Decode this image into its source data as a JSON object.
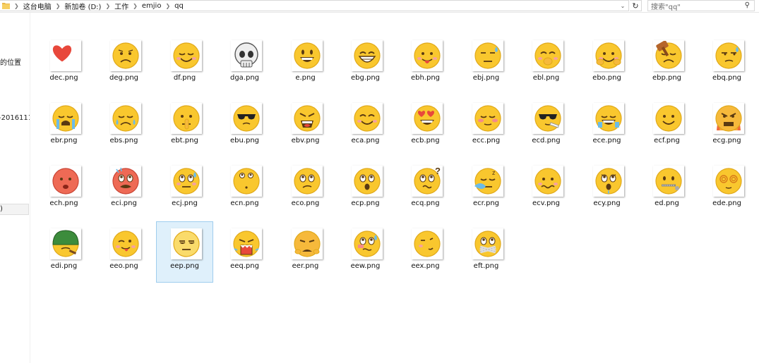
{
  "breadcrumb": [
    "这台电脑",
    "新加卷 (D:)",
    "工作",
    "emjio",
    "qq"
  ],
  "search": {
    "placeholder": "搜索\"qq\""
  },
  "nav": {
    "items": [
      {
        "label": "的位置"
      },
      {
        "label": "-2016111"
      },
      {
        "label": ")"
      }
    ]
  },
  "files": [
    {
      "name": "dec.png",
      "icon": "heart-icon"
    },
    {
      "name": "deg.png",
      "icon": "sad-face-icon"
    },
    {
      "name": "df.png",
      "icon": "relieved-face-icon"
    },
    {
      "name": "dga.png",
      "icon": "skull-icon"
    },
    {
      "name": "e.png",
      "icon": "grinning-face-icon"
    },
    {
      "name": "ebg.png",
      "icon": "big-grin-face-icon"
    },
    {
      "name": "ebh.png",
      "icon": "tongue-face-icon"
    },
    {
      "name": "ebj.png",
      "icon": "sweat-face-icon"
    },
    {
      "name": "ebl.png",
      "icon": "giggle-face-icon"
    },
    {
      "name": "ebo.png",
      "icon": "cheek-hold-face-icon"
    },
    {
      "name": "ebp.png",
      "icon": "hammer-face-icon"
    },
    {
      "name": "ebq.png",
      "icon": "smirk-sweat-face-icon"
    },
    {
      "name": "ebr.png",
      "icon": "crying-face-icon"
    },
    {
      "name": "ebs.png",
      "icon": "tearful-face-icon"
    },
    {
      "name": "ebt.png",
      "icon": "shush-face-icon"
    },
    {
      "name": "ebu.png",
      "icon": "sunglasses-face-icon"
    },
    {
      "name": "ebv.png",
      "icon": "angry-shout-face-icon"
    },
    {
      "name": "eca.png",
      "icon": "smile-face-icon"
    },
    {
      "name": "ecb.png",
      "icon": "heart-eyes-face-icon"
    },
    {
      "name": "ecc.png",
      "icon": "blush-face-icon"
    },
    {
      "name": "ecd.png",
      "icon": "cool-cigar-face-icon"
    },
    {
      "name": "ece.png",
      "icon": "laugh-tears-face-icon"
    },
    {
      "name": "ecf.png",
      "icon": "simple-smile-face-icon"
    },
    {
      "name": "ecg.png",
      "icon": "furious-face-icon"
    },
    {
      "name": "ech.png",
      "icon": "red-dizzy-face-icon"
    },
    {
      "name": "eci.png",
      "icon": "red-angry-face-icon"
    },
    {
      "name": "ecj.png",
      "icon": "worried-sweat-face-icon"
    },
    {
      "name": "ecn.png",
      "icon": "eyes-up-face-icon"
    },
    {
      "name": "eco.png",
      "icon": "skeptical-face-icon"
    },
    {
      "name": "ecp.png",
      "icon": "shocked-face-icon"
    },
    {
      "name": "ecq.png",
      "icon": "confused-face-icon"
    },
    {
      "name": "ecr.png",
      "icon": "sleepy-face-icon"
    },
    {
      "name": "ecv.png",
      "icon": "wavy-mouth-face-icon"
    },
    {
      "name": "ecy.png",
      "icon": "scared-face-icon"
    },
    {
      "name": "ed.png",
      "icon": "zipper-mouth-face-icon"
    },
    {
      "name": "ede.png",
      "icon": "dizzy-spiral-face-icon"
    },
    {
      "name": "edi.png",
      "icon": "helmet-face-icon"
    },
    {
      "name": "eeo.png",
      "icon": "wink-tongue-face-icon"
    },
    {
      "name": "eep.png",
      "icon": "unamused-face-icon"
    },
    {
      "name": "eeq.png",
      "icon": "screaming-face-icon"
    },
    {
      "name": "eer.png",
      "icon": "frowning-face-icon"
    },
    {
      "name": "eew.png",
      "icon": "nervous-face-icon"
    },
    {
      "name": "eex.png",
      "icon": "side-smile-face-icon"
    },
    {
      "name": "eft.png",
      "icon": "bandaged-face-icon"
    }
  ],
  "selected_file": "eep.png",
  "colors": {
    "selection_bg": "#dff0fb",
    "selection_border": "#9fcdee",
    "emoji_yellow": "#f9c72e"
  }
}
